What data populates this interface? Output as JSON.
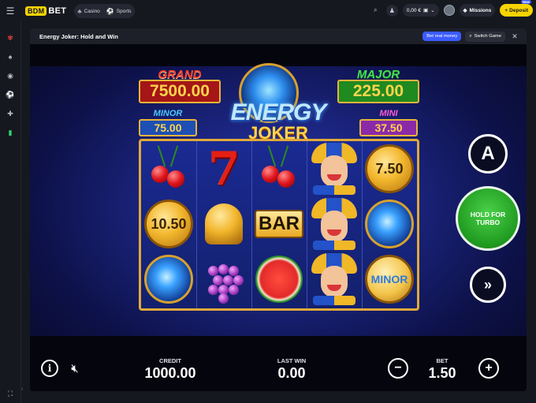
{
  "topbar": {
    "brand_badge": "BDM",
    "brand_text": "BET",
    "nav": [
      {
        "label": "Casino",
        "icon": "casino-icon"
      },
      {
        "label": "Sports",
        "icon": "sports-icon"
      }
    ],
    "balance": "0,00 €",
    "missions_label": "Missions",
    "deposit_label": "Deposit",
    "deposit_badge": "New"
  },
  "sidebar": {
    "icons": [
      "casino-chip-icon",
      "poker-chip-icon",
      "live-icon",
      "football-icon",
      "gamepad-icon",
      "mobile-icon"
    ],
    "bottom_icon": "fullscreen-icon"
  },
  "frame": {
    "title": "Energy Joker: Hold and Win",
    "bet_real_money": "Bet real money",
    "switch_game": "Switch Game"
  },
  "game": {
    "jackpots": {
      "grand": {
        "label": "GRAND",
        "value": "7500.00"
      },
      "major": {
        "label": "MAJOR",
        "value": "225.00"
      },
      "minor": {
        "label": "MINOR",
        "value": "75.00"
      },
      "mini": {
        "label": "MINI",
        "value": "37.50"
      }
    },
    "logo_line1": "ENERGY",
    "logo_line2": "JOKER",
    "reels": [
      [
        "cherries",
        "coin:10.50",
        "orb"
      ],
      [
        "seven",
        "bell",
        "grapes"
      ],
      [
        "cherries",
        "bar",
        "watermelon"
      ],
      [
        "joker",
        "joker",
        "joker"
      ],
      [
        "coin:7.50",
        "orb",
        "coin:MINOR"
      ]
    ],
    "coin_values": {
      "r1": "10.50",
      "r5a": "7.50",
      "r5c": "MINOR"
    },
    "bar_label": "BAR",
    "seven_label": "7",
    "autoplay_label": "A",
    "turbo_line1": "HOLD FOR",
    "turbo_line2": "TURBO",
    "credit_label": "CREDIT",
    "credit_value": "1000.00",
    "last_win_label": "LAST WIN",
    "last_win_value": "0.00",
    "bet_label": "BET",
    "bet_value": "1.50"
  },
  "colors": {
    "accent_yellow": "#f5d400",
    "primary_blue": "#3b5bfd",
    "turbo_green": "#1f9a1f"
  }
}
